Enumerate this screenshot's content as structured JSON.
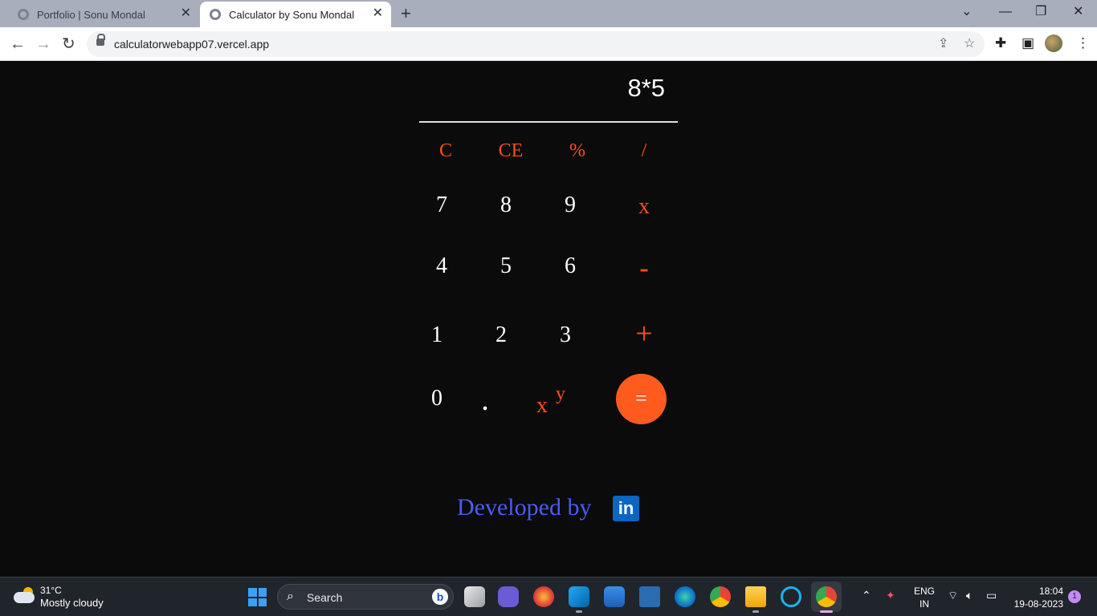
{
  "browser": {
    "tabs": [
      {
        "label": "Portfolio | Sonu Mondal",
        "active": false
      },
      {
        "label": "Calculator by Sonu Mondal",
        "active": true
      }
    ],
    "new_tab_label": "+",
    "url": "calculatorwebapp07.vercel.app"
  },
  "calculator": {
    "display": "8*5",
    "row1": [
      "C",
      "CE",
      "%",
      "/"
    ],
    "row2": [
      "7",
      "8",
      "9",
      "x"
    ],
    "row3": [
      "4",
      "5",
      "6",
      "-"
    ],
    "row4": [
      "1",
      "2",
      "3",
      "+"
    ],
    "row5": [
      "0",
      "."
    ],
    "power_base": "x",
    "power_exp": "y",
    "equals": "=",
    "accent_color": "#ff5b1f"
  },
  "footer": {
    "credit": "Developed by",
    "linkedin_label": "in"
  },
  "taskbar": {
    "weather_temp": "31°C",
    "weather_desc": "Mostly cloudy",
    "search_placeholder": "Search",
    "lang_top": "ENG",
    "lang_bottom": "IN",
    "time": "18:04",
    "date": "19-08-2023",
    "notification_count": "1"
  }
}
